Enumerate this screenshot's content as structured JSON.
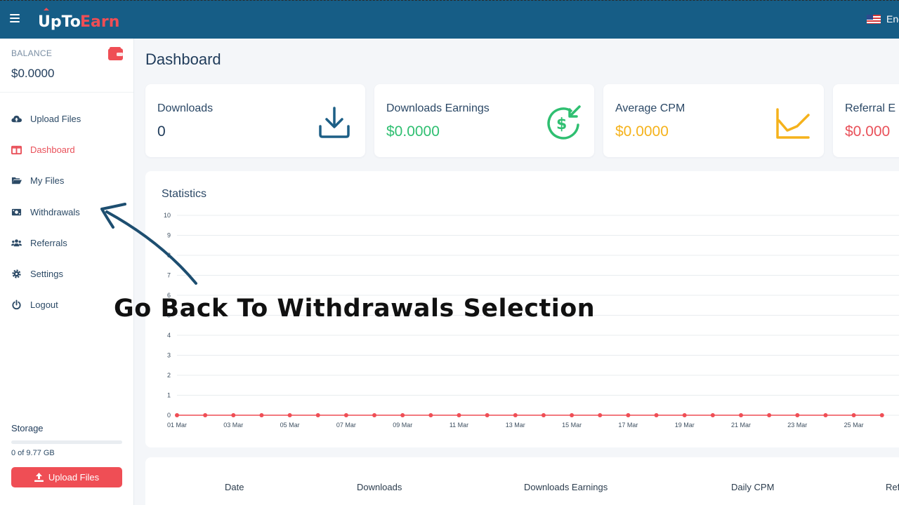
{
  "app": {
    "logo": "UpToEarn",
    "language": "Eng"
  },
  "sidebar": {
    "balance_label": "BALANCE",
    "balance_value": "$0.0000",
    "items": [
      {
        "label": "Upload Files",
        "icon": "cloud-upload-icon",
        "active": false
      },
      {
        "label": "Dashboard",
        "icon": "columns-icon",
        "active": true
      },
      {
        "label": "My Files",
        "icon": "folder-open-icon",
        "active": false
      },
      {
        "label": "Withdrawals",
        "icon": "money-bill-icon",
        "active": false
      },
      {
        "label": "Referrals",
        "icon": "users-icon",
        "active": false
      },
      {
        "label": "Settings",
        "icon": "gear-icon",
        "active": false
      },
      {
        "label": "Logout",
        "icon": "power-icon",
        "active": false
      }
    ],
    "storage_label": "Storage",
    "storage_text": "0 of 9.77 GB",
    "storage_used_fraction": 0,
    "upload_button": "Upload Files"
  },
  "main": {
    "title": "Dashboard",
    "cards": [
      {
        "label": "Downloads",
        "value": "0",
        "color": "#1f3b5a",
        "icon": "download-icon"
      },
      {
        "label": "Downloads Earnings",
        "value": "$0.0000",
        "color": "#2fbf71",
        "icon": "dollar-cycle-icon"
      },
      {
        "label": "Average CPM",
        "value": "$0.0000",
        "color": "#f5b21b",
        "icon": "line-chart-icon"
      },
      {
        "label": "Referral E",
        "value": "$0.000",
        "color": "#e9515a",
        "icon": ""
      }
    ],
    "statistics_title": "Statistics",
    "table_headers": [
      "Date",
      "Downloads",
      "Downloads Earnings",
      "Daily CPM",
      "Ref"
    ]
  },
  "chart_data": {
    "type": "line",
    "title": "Statistics",
    "xlabel": "",
    "ylabel": "",
    "ylim": [
      0,
      10
    ],
    "yticks": [
      0,
      1,
      2,
      3,
      4,
      5,
      6,
      7,
      8,
      9,
      10
    ],
    "x": [
      "01 Mar",
      "02 Mar",
      "03 Mar",
      "04 Mar",
      "05 Mar",
      "06 Mar",
      "07 Mar",
      "08 Mar",
      "09 Mar",
      "10 Mar",
      "11 Mar",
      "12 Mar",
      "13 Mar",
      "14 Mar",
      "15 Mar",
      "16 Mar",
      "17 Mar",
      "18 Mar",
      "19 Mar",
      "20 Mar",
      "21 Mar",
      "22 Mar",
      "23 Mar",
      "24 Mar",
      "25 Mar",
      "26 Mar"
    ],
    "xtick_labels": [
      "01 Mar",
      "03 Mar",
      "05 Mar",
      "07 Mar",
      "09 Mar",
      "11 Mar",
      "13 Mar",
      "15 Mar",
      "17 Mar",
      "19 Mar",
      "21 Mar",
      "23 Mar",
      "25 Mar"
    ],
    "series": [
      {
        "values": [
          0,
          0,
          0,
          0,
          0,
          0,
          0,
          0,
          0,
          0,
          0,
          0,
          0,
          0,
          0,
          0,
          0,
          0,
          0,
          0,
          0,
          0,
          0,
          0,
          0,
          0
        ],
        "color": "#ef4e55"
      }
    ],
    "grid": true
  },
  "overlay": {
    "caption": "Go Back To Withdrawals Selection"
  }
}
